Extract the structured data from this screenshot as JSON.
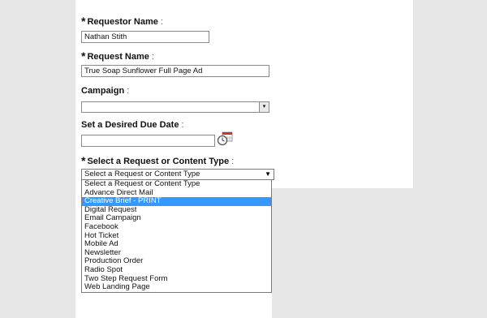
{
  "form": {
    "requestor_name": {
      "label": "Requestor Name",
      "required": "*",
      "colon": ":",
      "value": "Nathan Stith"
    },
    "request_name": {
      "label": "Request Name",
      "required": "*",
      "colon": ":",
      "value": "True Soap Sunflower Full Page Ad"
    },
    "campaign": {
      "label": "Campaign",
      "colon": ":",
      "value": ""
    },
    "due_date": {
      "label": "Set a Desired Due Date",
      "colon": ":",
      "value": ""
    },
    "request_type": {
      "label": "Select a Request or Content Type",
      "required": "*",
      "colon": ":",
      "value": "Select a Request or Content Type",
      "arrow": "▼",
      "highlighted_index": 2,
      "options": [
        "Select a Request or Content Type",
        "Advance Direct Mail",
        "Creative Brief - PRINT",
        "Digital Request",
        "Email Campaign",
        "Facebook",
        "Hot Ticket",
        "Mobile Ad",
        "Newsletter",
        "Production Order",
        "Radio Spot",
        "Two Step Request Form",
        "Web Landing Page"
      ]
    }
  },
  "icons": {
    "calendar": "calendar-clock-icon",
    "campaign_arrow": "▾"
  },
  "colors": {
    "highlight": "#3399ff",
    "background": "#e6e6e6",
    "panel": "#ffffff"
  }
}
